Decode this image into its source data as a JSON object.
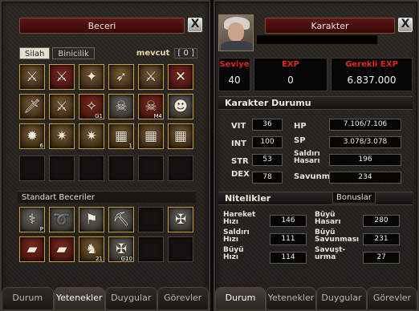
{
  "skill_window": {
    "title": "Beceri",
    "close": "X",
    "subtabs": [
      "Silah",
      "Binicilik"
    ],
    "mevcut_label": "mevcut",
    "mevcut_value": "[ 0 ]",
    "skill_slots": [
      {
        "icon": "weapon-skill-icon",
        "glyph": "⚔",
        "lvl": ""
      },
      {
        "icon": "weapon-skill-icon",
        "glyph": "⚔",
        "lvl": ""
      },
      {
        "icon": "weapon-skill-icon",
        "glyph": "✦",
        "lvl": ""
      },
      {
        "icon": "weapon-skill-icon",
        "glyph": "➶",
        "lvl": ""
      },
      {
        "icon": "weapon-skill-icon",
        "glyph": "⚔",
        "lvl": ""
      },
      {
        "icon": "weapon-skill-icon",
        "glyph": "✕",
        "lvl": ""
      },
      {
        "icon": "sword-skill-icon",
        "glyph": "🗡",
        "lvl": ""
      },
      {
        "icon": "sword-skill-icon",
        "glyph": "⚔",
        "lvl": ""
      },
      {
        "icon": "blade-skill-icon",
        "glyph": "✧",
        "lvl": "G1"
      },
      {
        "icon": "mask-skill-icon",
        "glyph": "☠",
        "lvl": ""
      },
      {
        "icon": "skull-skill-icon",
        "glyph": "☠",
        "lvl": "M4"
      },
      {
        "icon": "mask-skill-icon",
        "glyph": "☻",
        "lvl": ""
      },
      {
        "icon": "bug-skill-icon",
        "glyph": "✹",
        "lvl": "6"
      },
      {
        "icon": "claw-skill-icon",
        "glyph": "✷",
        "lvl": ""
      },
      {
        "icon": "claw-skill-icon",
        "glyph": "✷",
        "lvl": ""
      },
      {
        "icon": "rune-skill-icon",
        "glyph": "▦",
        "lvl": "1"
      },
      {
        "icon": "rune-skill-icon",
        "glyph": "▦",
        "lvl": ""
      },
      {
        "icon": "rune-skill-icon",
        "glyph": "▦",
        "lvl": ""
      }
    ],
    "standart_label": "Standart Beceriler",
    "standart_slots": [
      {
        "icon": "whip-skill-icon",
        "glyph": "⚕",
        "lvl": "P"
      },
      {
        "icon": "lasso-skill-icon",
        "glyph": "➰",
        "lvl": ""
      },
      {
        "icon": "flag-skill-icon",
        "glyph": "⚑",
        "lvl": ""
      },
      {
        "icon": "pickaxe-skill-icon",
        "glyph": "⛏",
        "lvl": ""
      },
      {
        "icon": "empty-slot",
        "glyph": "",
        "lvl": ""
      },
      {
        "icon": "knot-skill-icon",
        "glyph": "✠",
        "lvl": ""
      },
      {
        "icon": "book-skill-icon",
        "glyph": "▰",
        "lvl": ""
      },
      {
        "icon": "book-skill-icon",
        "glyph": "▰",
        "lvl": ""
      },
      {
        "icon": "horse-skill-icon",
        "glyph": "♞",
        "lvl": "21"
      },
      {
        "icon": "knot-skill-icon",
        "glyph": "✠",
        "lvl": "G10"
      },
      {
        "icon": "empty-slot",
        "glyph": "",
        "lvl": ""
      },
      {
        "icon": "empty-slot",
        "glyph": "",
        "lvl": ""
      }
    ],
    "tabs": [
      "Durum",
      "Yetenekler",
      "Duygular",
      "Görevler"
    ]
  },
  "char_window": {
    "title": "Karakter",
    "close": "X",
    "level_label": "Seviye",
    "level_value": "40",
    "exp_label": "EXP",
    "exp_value": "0",
    "req_exp_label": "Gerekli EXP",
    "req_exp_value": "6.837.000",
    "status_title": "Karakter Durumu",
    "stats": {
      "vit_label": "VIT",
      "vit": "36",
      "int_label": "INT",
      "int": "100",
      "str_label": "STR",
      "str": "53",
      "dex_label": "DEX",
      "dex": "78",
      "hp_label": "HP",
      "hp": "7.106/7.106",
      "sp_label": "SP",
      "sp": "3.078/3.078",
      "atk_label": "Saldırı Hasarı",
      "atk": "196",
      "def_label": "Savunma",
      "def": "234"
    },
    "attr_title": "Nitelikler",
    "bonus_tab": "Bonuslar",
    "attrs": {
      "move_label": "Hareket Hızı",
      "move": "146",
      "atkspd_label": "Saldırı Hızı",
      "atkspd": "111",
      "magspd_label": "Büyü Hızı",
      "magspd": "114",
      "magatk_label": "Büyü Hasarı",
      "magatk": "280",
      "magdef_label": "Büyü Savunması",
      "magdef": "231",
      "dodge_label": "Savuşt-urma",
      "dodge": "27"
    },
    "tabs": [
      "Durum",
      "Yetenekler",
      "Duygular",
      "Görevler"
    ]
  },
  "colors": {
    "title_red": "#4a0e0a",
    "label_red": "#e02a1c",
    "gold_border": "#c8a038"
  }
}
